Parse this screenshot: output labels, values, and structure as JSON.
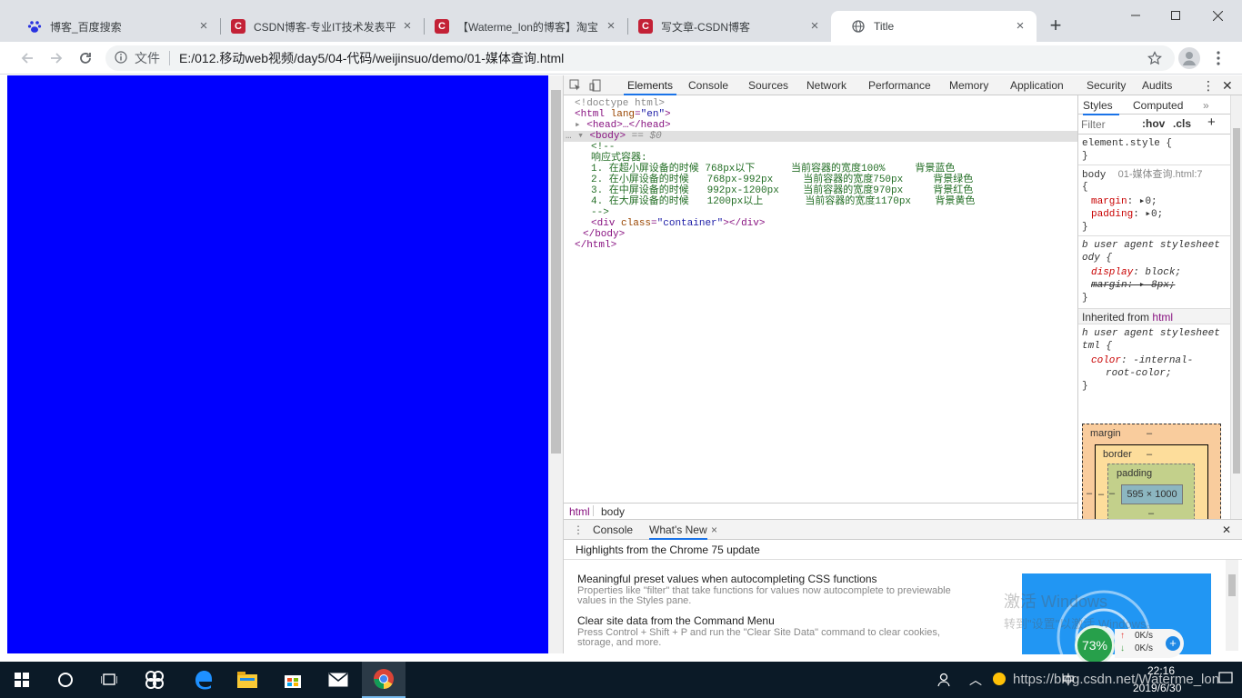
{
  "browser": {
    "tabs": [
      {
        "title": "博客_百度搜索",
        "icon": "baidu-paw-icon"
      },
      {
        "title": "CSDN博客-专业IT技术发表平",
        "icon": "csdn-icon"
      },
      {
        "title": "【Waterme_lon的博客】淘宝",
        "icon": "csdn-icon"
      },
      {
        "title": "写文章-CSDN博客",
        "icon": "csdn-icon"
      },
      {
        "title": "Title",
        "icon": "globe-icon"
      }
    ],
    "address": {
      "scheme_label": "文件",
      "url": "E:/012.移动web视频/day5/04-代码/weijinsuo/demo/01-媒体查询.html"
    },
    "page_background": "#0000ff"
  },
  "devtools": {
    "tabs": [
      "Elements",
      "Console",
      "Sources",
      "Network",
      "Performance",
      "Memory",
      "Application",
      "Security",
      "Audits"
    ],
    "dom": {
      "doctype": "<!doctype html>",
      "html_open": "<html",
      "html_lang_attr": "lang",
      "html_lang_val": "\"en\"",
      "head": "<head>…</head>",
      "body_open": "<body>",
      "body_eq": "== $0",
      "comment_open": "<!--",
      "comment_title": "响应式容器:",
      "comment_lines": [
        "1. 在超小屏设备的时候 768px以下      当前容器的宽度100%     背景蓝色",
        "2. 在小屏设备的时候   768px-992px     当前容器的宽度750px     背景绿色",
        "3. 在中屏设备的时候   992px-1200px    当前容器的宽度970px     背景红色",
        "4. 在大屏设备的时候   1200px以上       当前容器的宽度1170px    背景黄色"
      ],
      "comment_close": "-->",
      "div_open": "<div",
      "div_class_attr": "class",
      "div_class_val": "\"container\"",
      "div_close": "></div>",
      "body_close": "</body>",
      "html_close": "</html>"
    },
    "breadcrumbs": [
      "html",
      "body"
    ],
    "styles": {
      "tabs": [
        "Styles",
        "Computed"
      ],
      "filter_placeholder": "Filter",
      "hov": ":hov",
      "cls": ".cls",
      "element_style": "element.style {",
      "close_brace": "}",
      "body_selector": "body",
      "body_source": "01-媒体查询.html:7",
      "open_brace": "{",
      "margin_prop": "margin",
      "margin_val": "0;",
      "padding_prop": "padding",
      "padding_val": "0;",
      "ua_label": "user agent stylesheet",
      "ua_body_selector": "b",
      "ua_body_selector_rest": "ody {",
      "display_prop": "display",
      "display_val": "block;",
      "margin8": "margin: ▸ 8px;",
      "inherited_from": "Inherited from",
      "inherited_tag": "html",
      "ua_html_selector": "h",
      "ua_html_selector_rest": "tml {",
      "color_prop": "color",
      "color_val_1": "-internal-",
      "color_val_2": "root-color;"
    },
    "box_model": {
      "margin_label": "margin",
      "border_label": "border",
      "padding_label": "padding",
      "dash": "–",
      "content_size": "595 × 1000"
    },
    "drawer": {
      "tabs": [
        "Console",
        "What's New"
      ],
      "header": "Highlights from the Chrome 75 update",
      "items": [
        {
          "title": "Meaningful preset values when autocompleting CSS functions",
          "desc": "Properties like \"filter\" that take functions for values now autocomplete to previewable values in the Styles pane."
        },
        {
          "title": "Clear site data from the Command Menu",
          "desc": "Press Control + Shift + P and run the \"Clear Site Data\" command to clear cookies, storage, and more."
        }
      ]
    }
  },
  "overlay": {
    "activate_title": "激活 Windows",
    "activate_sub": "转到\"设置\"以激活 Windows。",
    "speed_percent": "73%",
    "upload": "0K/s",
    "download": "0K/s"
  },
  "taskbar": {
    "time": "22:16",
    "date": "2019/6/30",
    "ime": "中",
    "watermark": "https://blog.csdn.net/Waterme_lon"
  }
}
